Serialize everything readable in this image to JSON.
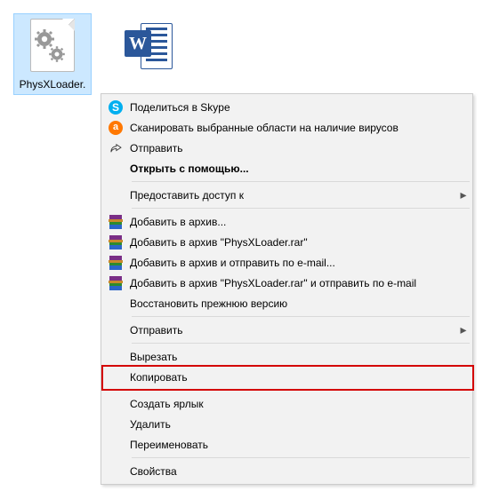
{
  "files": {
    "physx": {
      "label": "PhysXLoader."
    },
    "word": {
      "label": ""
    }
  },
  "menu": {
    "skype": "Поделиться в Skype",
    "scan": "Сканировать выбранные области на наличие вирусов",
    "sendto_top": "Отправить",
    "open_with": "Открыть с помощью...",
    "grant_access": "Предоставить доступ к",
    "rar_add": "Добавить в архив...",
    "rar_add_name": "Добавить в архив \"PhysXLoader.rar\"",
    "rar_email": "Добавить в архив и отправить по e-mail...",
    "rar_email_name": "Добавить в архив \"PhysXLoader.rar\" и отправить по e-mail",
    "restore": "Восстановить прежнюю версию",
    "sendto": "Отправить",
    "cut": "Вырезать",
    "copy": "Копировать",
    "shortcut": "Создать ярлык",
    "delete": "Удалить",
    "rename": "Переименовать",
    "properties": "Свойства"
  },
  "highlight": "copy"
}
